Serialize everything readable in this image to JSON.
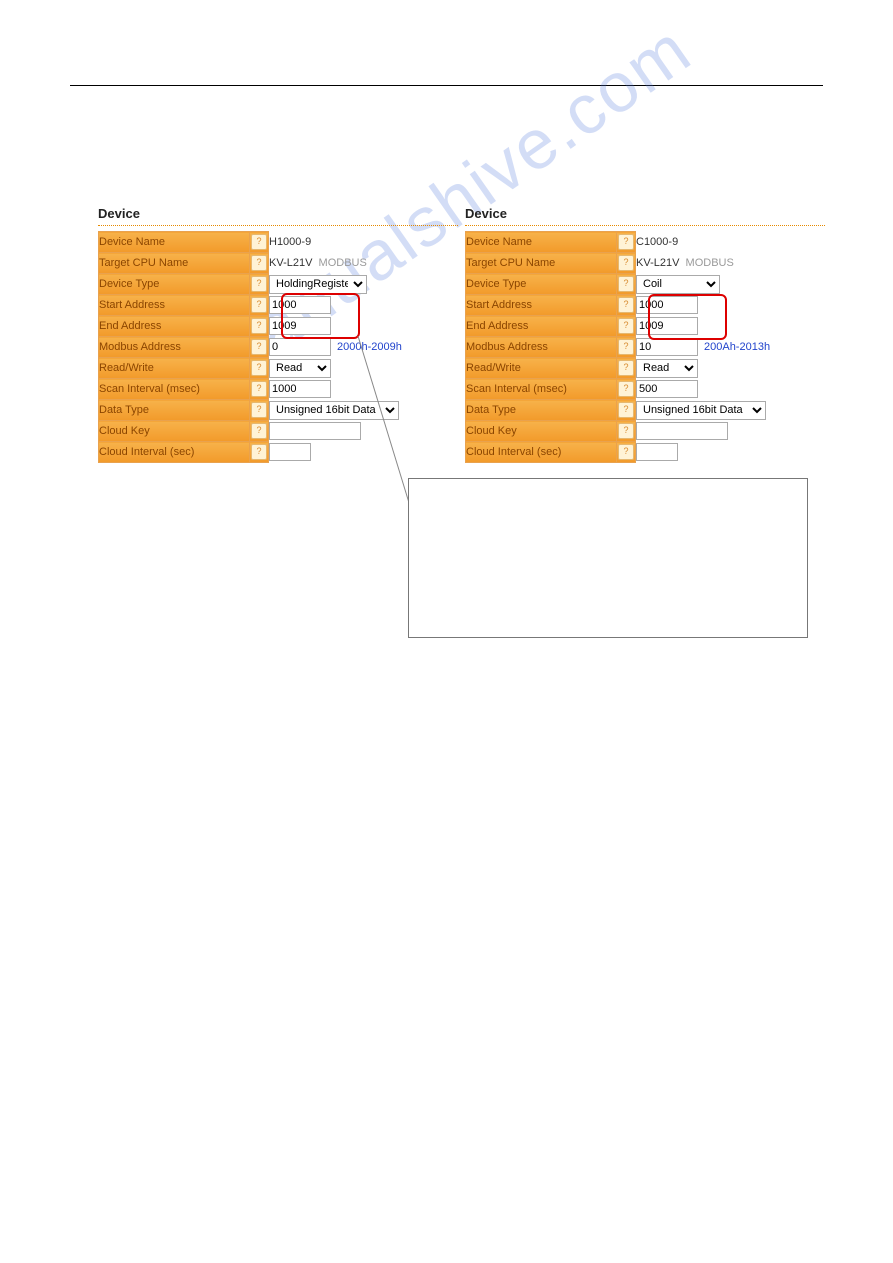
{
  "watermark": "manualshive.com",
  "heading": "Device",
  "left": {
    "fields": {
      "device_name": {
        "label": "Device Name",
        "value": "H1000-9"
      },
      "target_cpu": {
        "label": "Target CPU Name",
        "value": "KV-L21V",
        "suffix": "MODBUS"
      },
      "device_type": {
        "label": "Device Type",
        "select": "HoldingRegister"
      },
      "start_addr": {
        "label": "Start Address",
        "input": "1000"
      },
      "end_addr": {
        "label": "End Address",
        "input": "1009"
      },
      "modbus_addr": {
        "label": "Modbus Address",
        "input": "0",
        "note": "2000h-2009h"
      },
      "read_write": {
        "label": "Read/Write",
        "select": "Read"
      },
      "scan_int": {
        "label": "Scan Interval (msec)",
        "input": "1000"
      },
      "data_type": {
        "label": "Data Type",
        "select": "Unsigned 16bit Data"
      },
      "cloud_key": {
        "label": "Cloud Key",
        "input": ""
      },
      "cloud_int": {
        "label": "Cloud Interval (sec)",
        "input": ""
      }
    }
  },
  "right": {
    "fields": {
      "device_name": {
        "label": "Device Name",
        "value": "C1000-9"
      },
      "target_cpu": {
        "label": "Target CPU Name",
        "value": "KV-L21V",
        "suffix": "MODBUS"
      },
      "device_type": {
        "label": "Device Type",
        "select": "Coil"
      },
      "start_addr": {
        "label": "Start Address",
        "input": "1000"
      },
      "end_addr": {
        "label": "End Address",
        "input": "1009"
      },
      "modbus_addr": {
        "label": "Modbus Address",
        "input": "10",
        "note": "200Ah-2013h"
      },
      "read_write": {
        "label": "Read/Write",
        "select": "Read"
      },
      "scan_int": {
        "label": "Scan Interval (msec)",
        "input": "500"
      },
      "data_type": {
        "label": "Data Type",
        "select": "Unsigned 16bit Data"
      },
      "cloud_key": {
        "label": "Cloud Key",
        "input": ""
      },
      "cloud_int": {
        "label": "Cloud Interval (sec)",
        "input": ""
      }
    }
  }
}
